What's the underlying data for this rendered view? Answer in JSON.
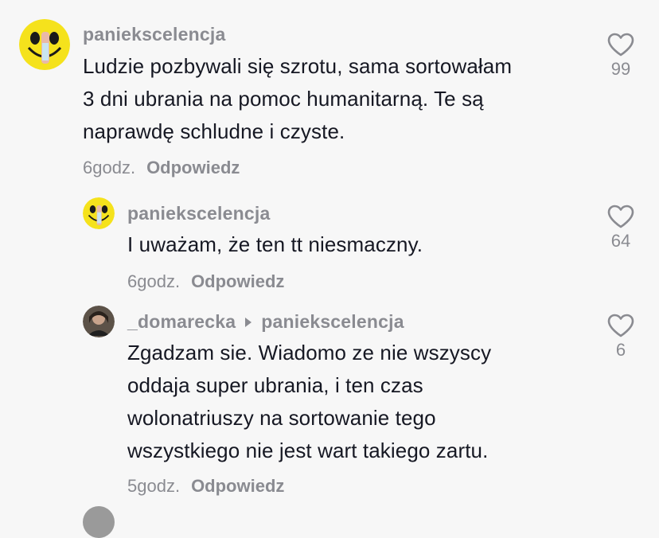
{
  "comments": [
    {
      "username": "paniekscelencja",
      "text_lines": [
        "Ludzie pozbywali się szrotu, sama sortowałam",
        "3 dni ubrania na pomoc humanitarną. Te są",
        "naprawdę schludne i czyste."
      ],
      "time": "6godz.",
      "reply_label": "Odpowiedz",
      "likes": "99"
    },
    {
      "username": "paniekscelencja",
      "text_lines": [
        "I uważam, że ten tt niesmaczny."
      ],
      "time": "6godz.",
      "reply_label": "Odpowiedz",
      "likes": "64"
    },
    {
      "username": "_domarecka",
      "reply_to": "paniekscelencja",
      "text_lines": [
        "Zgadzam sie. Wiadomo ze nie wszyscy",
        "oddaja super ubrania, i ten czas",
        "wolonatriuszy na sortowanie tego",
        "wszystkiego nie jest wart takiego zartu."
      ],
      "time": "5godz.",
      "reply_label": "Odpowiedz",
      "likes": "6"
    }
  ],
  "icons": {
    "like": "heart-outline-icon",
    "reply_arrow": "triangle-right-icon",
    "avatar_smiley": "smiley-avatar"
  },
  "colors": {
    "background": "#f7f7f7",
    "text": "#161823",
    "secondary": "#8a8b91",
    "avatar_yellow": "#f5e21c"
  }
}
